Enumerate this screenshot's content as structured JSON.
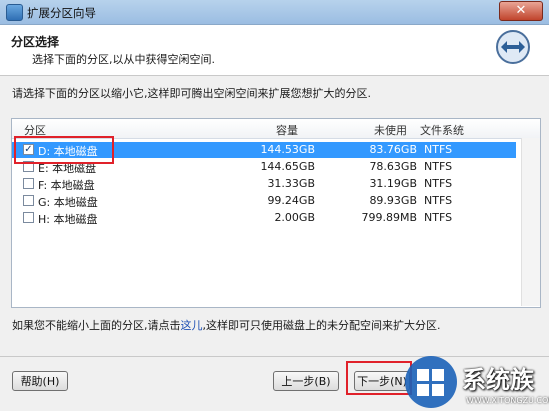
{
  "window": {
    "title": "扩展分区向导",
    "close_label": "✕"
  },
  "header": {
    "title": "分区选择",
    "subtitle": "选择下面的分区,以从中获得空闲空间."
  },
  "instruction": "请选择下面的分区以缩小它,这样即可腾出空闲空间来扩展您想扩大的分区.",
  "table": {
    "columns": [
      "分区",
      "容量",
      "未使用",
      "文件系统"
    ],
    "rows": [
      {
        "name": "D: 本地磁盘",
        "capacity": "144.53GB",
        "free": "83.76GB",
        "fs": "NTFS",
        "checked": true
      },
      {
        "name": "E: 本地磁盘",
        "capacity": "144.65GB",
        "free": "78.63GB",
        "fs": "NTFS",
        "checked": false
      },
      {
        "name": "F: 本地磁盘",
        "capacity": "31.33GB",
        "free": "31.19GB",
        "fs": "NTFS",
        "checked": false
      },
      {
        "name": "G: 本地磁盘",
        "capacity": "99.24GB",
        "free": "89.93GB",
        "fs": "NTFS",
        "checked": false
      },
      {
        "name": "H: 本地磁盘",
        "capacity": "2.00GB",
        "free": "799.89MB",
        "fs": "NTFS",
        "checked": false
      }
    ]
  },
  "note": {
    "before": "如果您不能缩小上面的分区,请点击",
    "link": "这儿",
    "after": ",这样即可只使用磁盘上的未分配空间来扩大分区."
  },
  "buttons": {
    "help": "帮助(H)",
    "back": "上一步(B)",
    "next": "下一步(N)"
  },
  "watermark": {
    "brand": "系统族",
    "url": "WWW.XITONGZU.COM"
  },
  "colors": {
    "selection": "#3399ff",
    "highlight": "#e0212a"
  }
}
